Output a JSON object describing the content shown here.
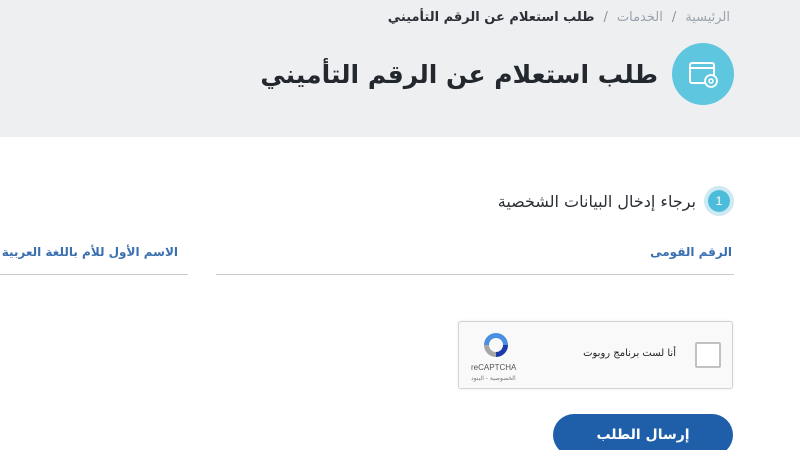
{
  "breadcrumb": {
    "home": "الرئيسية",
    "services": "الخدمات",
    "current": "طلب استعلام عن الرقم التأميني",
    "separator": "/"
  },
  "page": {
    "title": "طلب استعلام عن الرقم التأميني",
    "icon": "browser-settings-icon"
  },
  "step": {
    "number": "1",
    "title": "برجاء إدخال البيانات الشخصية"
  },
  "fields": {
    "national_id_label": "الرقم القومى",
    "mother_first_name_label": "الاسم الأول للأم باللغة العربية"
  },
  "captcha": {
    "label": "أنا لست برنامج روبوت",
    "brand": "reCAPTCHA",
    "links": "الخصوصية - البنود"
  },
  "submit": {
    "label": "إرسال الطلب"
  },
  "colors": {
    "header_bg": "#eeeff1",
    "accent_cyan": "#5fc6e0",
    "button_blue": "#1f5ea8",
    "label_blue": "#3a6fb0"
  }
}
